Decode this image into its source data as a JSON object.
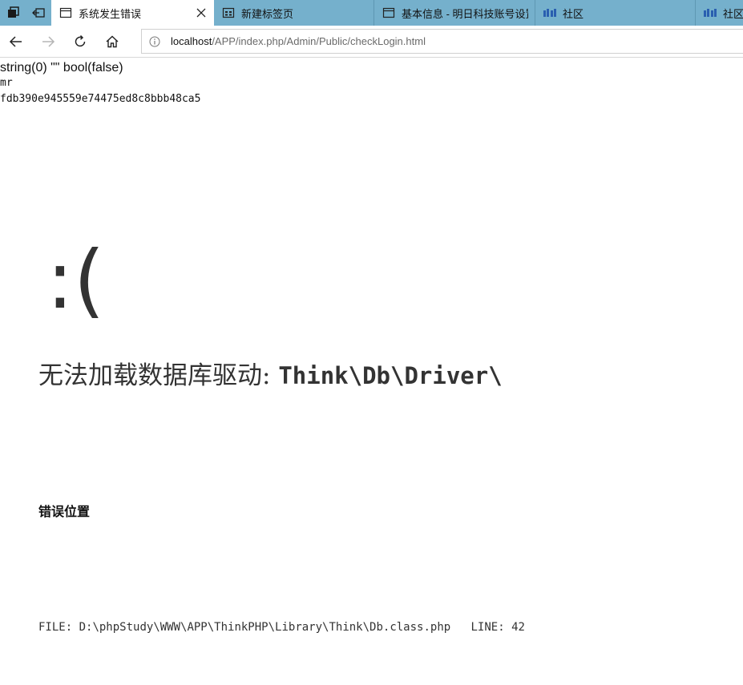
{
  "browser": {
    "tabs": [
      {
        "label": "系统发生错误",
        "active": true,
        "icon": "page-icon"
      },
      {
        "label": "新建标签页",
        "active": false,
        "icon": "new-tab-page-icon"
      },
      {
        "label": "基本信息 - 明日科技账号设置",
        "active": false,
        "icon": "page-icon"
      },
      {
        "label": "社区",
        "active": false,
        "icon": "community-logo-icon"
      },
      {
        "label": "社区",
        "active": false,
        "icon": "community-logo-icon"
      }
    ],
    "address": {
      "host": "localhost",
      "path": "/APP/index.php/Admin/Public/checkLogin.html"
    },
    "colors": {
      "tab_strip": "#75b0cc",
      "active_tab": "#ffffff"
    }
  },
  "page": {
    "dump_line": "string(0) \"\" bool(false)",
    "username": "mr",
    "hash": "fdb390e945559e74475ed8c8bbb48ca5",
    "face": ":(",
    "error_message_cn": "无法加载数据库驱动:",
    "error_message_code": "Think\\Db\\Driver\\",
    "location_label": "错误位置",
    "file_label": "FILE:",
    "file_path": "D:\\phpStudy\\WWW\\APP\\ThinkPHP\\Library\\Think\\Db.class.php",
    "line_label": "LINE:",
    "line_number": "42"
  }
}
